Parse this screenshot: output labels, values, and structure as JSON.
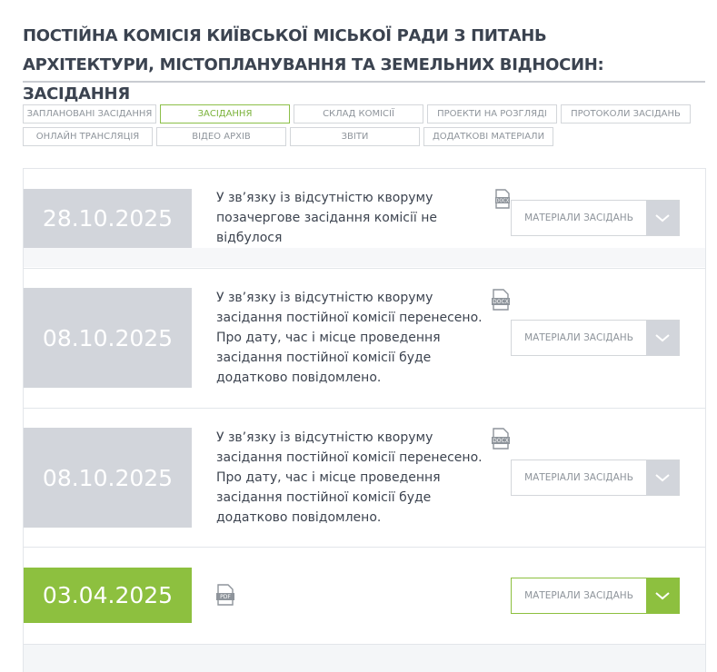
{
  "page": {
    "title": "ПОСТІЙНА КОМІСІЯ КИЇВСЬКОЇ МІСЬКОЇ РАДИ З ПИТАНЬ АРХІТЕКТУРИ, МІСТОПЛАНУВАННЯ ТА ЗЕМЕЛЬНИХ ВІДНОСИН: ЗАСІДАННЯ"
  },
  "tabs": {
    "row1": [
      {
        "label": "ЗАПЛАНОВАНІ ЗАСІДАННЯ",
        "active": false
      },
      {
        "label": "ЗАСІДАННЯ",
        "active": true
      },
      {
        "label": "СКЛАД КОМІСІЇ",
        "active": false
      },
      {
        "label": "ПРОЕКТИ НА РОЗГЛЯДІ",
        "active": false
      },
      {
        "label": "ПРОТОКОЛИ ЗАСІДАНЬ",
        "active": false
      }
    ],
    "row2": [
      {
        "label": "ОНЛАЙН ТРАНСЛЯЦІЯ",
        "active": false
      },
      {
        "label": "ВІДЕО АРХІВ",
        "active": false
      },
      {
        "label": "ЗВІТИ",
        "active": false
      },
      {
        "label": "ДОДАТКОВІ МАТЕРІАЛИ",
        "active": false
      }
    ]
  },
  "meetings": [
    {
      "date": "28.10.2025",
      "text": "У зв’язку із відсутністю кворуму позачергове засідання комісії не відбулося",
      "doc_icon": "docx-icon",
      "materials_label": "МАТЕРІАЛИ ЗАСІДАНЬ",
      "highlight": false
    },
    {
      "date": "08.10.2025",
      "text": "У зв’язку із відсутністю кворуму засідання постійної комісії перенесено. Про дату, час і місце проведення засідання постійної комісії буде додатково повідомлено.",
      "doc_icon": "docx-icon",
      "materials_label": "МАТЕРІАЛИ ЗАСІДАНЬ",
      "highlight": false
    },
    {
      "date": "08.10.2025",
      "text": "У зв’язку із відсутністю кворуму засідання постійної комісії перенесено. Про дату, час і місце проведення засідання постійної комісії буде додатково повідомлено.",
      "doc_icon": "docx-icon",
      "materials_label": "МАТЕРІАЛИ ЗАСІДАНЬ",
      "highlight": false
    },
    {
      "date": "03.04.2025",
      "text": "",
      "doc_icon": "pdf-icon",
      "materials_label": "МАТЕРІАЛИ ЗАСІДАНЬ",
      "highlight": true
    }
  ],
  "colors": {
    "accent_green": "#8dc03f",
    "date_gray": "#d2d5db",
    "title_text": "#3b4350"
  }
}
